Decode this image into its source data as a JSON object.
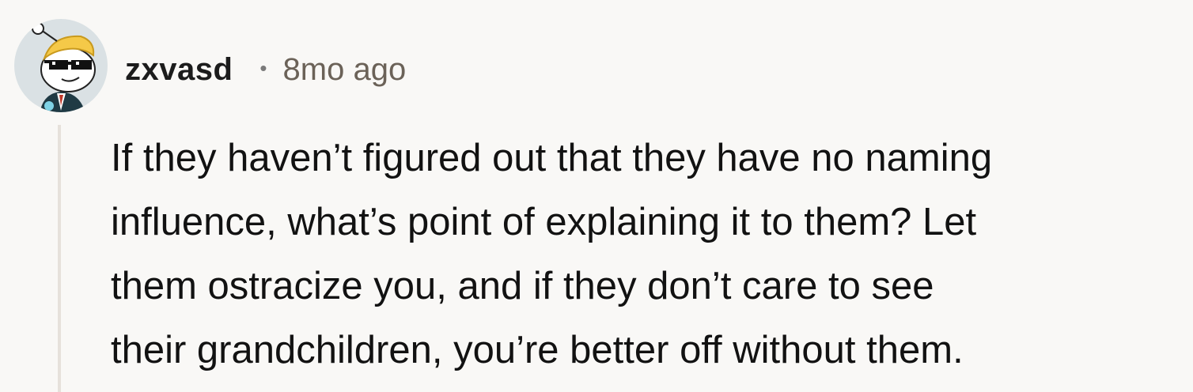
{
  "comment": {
    "username": "zxvasd",
    "separator": "•",
    "timestamp": "8mo ago",
    "body_lines": [
      "If they haven’t figured out that they have no naming",
      "influence, what’s point of explaining it to them? Let",
      "them ostracize you, and if they don’t care to see",
      "their grandchildren, you’re better off without them."
    ]
  },
  "avatar": {
    "icon": "snoo-avatar-icon",
    "background_color": "#dae1e4",
    "hair_color": "#f5c948"
  },
  "colors": {
    "page_background": "#f9f8f6",
    "thread_line": "#e6e1db",
    "text": "#121212",
    "meta_text": "#6b6258"
  }
}
